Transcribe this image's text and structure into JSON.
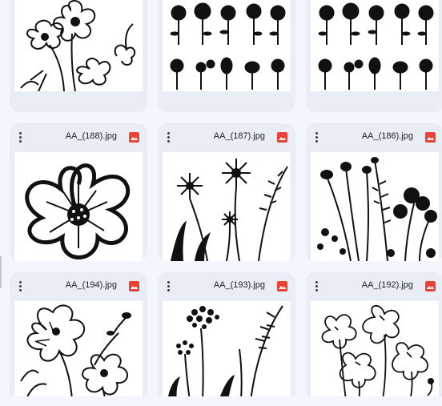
{
  "files": [
    {
      "name": ""
    },
    {
      "name": ""
    },
    {
      "name": ""
    },
    {
      "name": "AA_(188).jpg"
    },
    {
      "name": "AA_(187).jpg"
    },
    {
      "name": "AA_(186).jpg"
    },
    {
      "name": "AA_(194).jpg"
    },
    {
      "name": "AA_(193).jpg"
    },
    {
      "name": "AA_(192).jpg"
    }
  ],
  "icons": {
    "more": "kebab-menu-icon",
    "filetype": "image-file-icon"
  },
  "colors": {
    "card_bg": "#e9eef6",
    "page_bg": "#f3f6fc",
    "image_icon": "#ea4335"
  }
}
